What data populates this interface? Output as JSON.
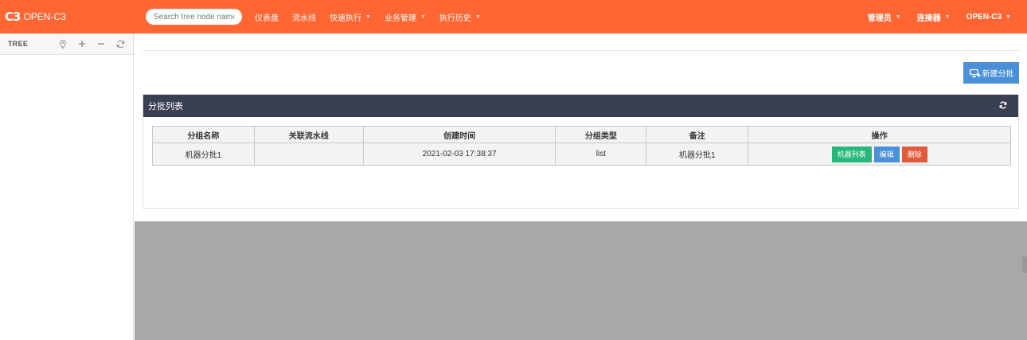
{
  "navbar": {
    "logo_text": "C3",
    "brand": "OPEN-C3",
    "search_placeholder": "Search tree node name",
    "items": [
      {
        "label": "仪表盘",
        "dropdown": false
      },
      {
        "label": "流水线",
        "dropdown": false
      },
      {
        "label": "快速执行",
        "dropdown": true
      },
      {
        "label": "业务管理",
        "dropdown": true
      },
      {
        "label": "执行历史",
        "dropdown": true
      }
    ],
    "right_items": [
      {
        "label": "管理员",
        "dropdown": true
      },
      {
        "label": "连接器",
        "dropdown": true
      },
      {
        "label": "OPEN-C3",
        "dropdown": true
      }
    ],
    "color": "#ff6633"
  },
  "sidebar": {
    "title": "TREE",
    "tools": [
      "pin-icon",
      "plus-icon",
      "minus-icon",
      "refresh-icon"
    ]
  },
  "main": {
    "new_button_label": "新建分批",
    "panel_title": "分批列表",
    "table": {
      "columns": [
        "分组名称",
        "关联流水线",
        "创建时间",
        "分组类型",
        "备注",
        "操作"
      ],
      "rows": [
        {
          "name": "机器分批1",
          "pipeline": "",
          "created": "2021-02-03 17:38:37",
          "type": "list",
          "note": "机器分批1",
          "actions": [
            "机器列表",
            "编辑",
            "删除"
          ]
        }
      ]
    }
  },
  "colors": {
    "accent": "#ff6633",
    "panel_header": "#3a3f51",
    "primary": "#4a90d9",
    "success": "#27b77a",
    "danger": "#e25a3c"
  }
}
